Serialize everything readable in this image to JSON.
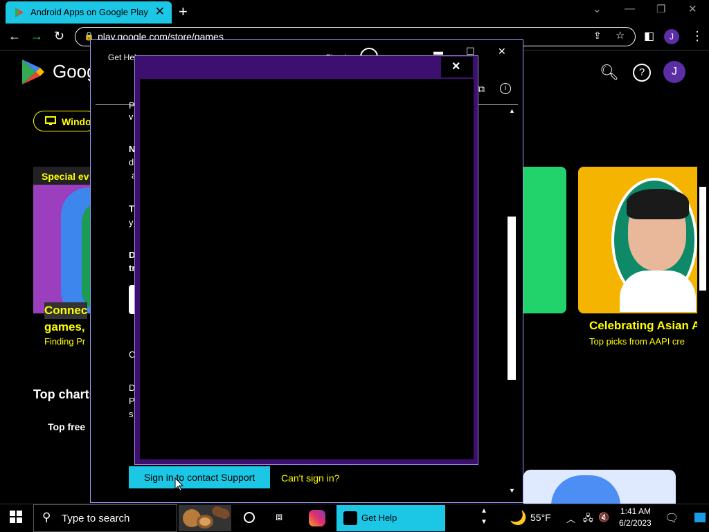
{
  "browser": {
    "tab_title": "Android Apps on Google Play",
    "tab_close": "✕",
    "new_tab": "+",
    "window_controls": [
      "⌄",
      "—",
      "❐",
      "✕"
    ],
    "url": "play.google.com/store/games",
    "profile_initial": "J"
  },
  "play": {
    "brand": "Goog",
    "profile_initial": "J",
    "device_chip": "Windo",
    "card1_tag": "Special ev",
    "card1_title_line1": "Connec",
    "card1_title_line2": "games,",
    "card1_sub": "Finding Pr",
    "card3_title": "Celebrating Asian A",
    "card3_sub": "Top picks from AAPI cre",
    "top_charts": "Top charts",
    "top_free": "Top free"
  },
  "get_help": {
    "title": "Get Hel",
    "sign_in": "Sign in",
    "fragments": [
      "P",
      "v",
      "N",
      "d",
      "a",
      "T",
      "y",
      "D",
      "tr",
      "O",
      "D",
      "P",
      "s"
    ],
    "sign_in_support": "Sign in to contact Support",
    "cant_sign_in": "Can't sign in?"
  },
  "dialog": {
    "close": "✕"
  },
  "taskbar": {
    "search_placeholder": "Type to search",
    "get_help_label": "Get Help",
    "temperature": "55°F",
    "time": "1:41 AM",
    "date": "6/2/2023"
  },
  "colors": {
    "accent_cyan": "#1cc7e6",
    "accent_yellow": "#ffff00",
    "dialog_purple": "#3d0f6e"
  }
}
